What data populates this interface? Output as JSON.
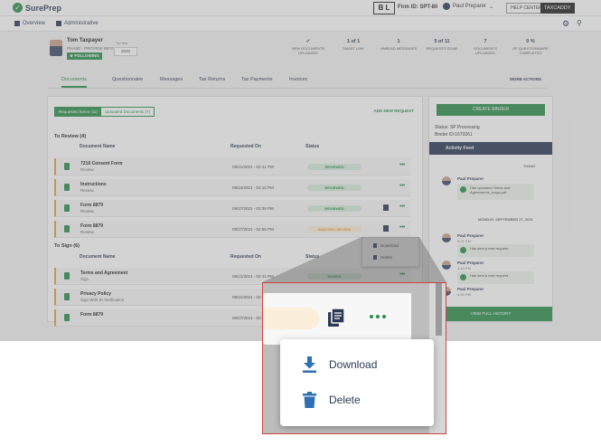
{
  "app": {
    "brand": "SurePrep",
    "bl_badge": "B L",
    "firm_id": "Firm ID: SPT-80",
    "user_name": "Paul Preparer",
    "help_center": "HELP CENTER",
    "taxcaddy": "TAXCADDY"
  },
  "nav": {
    "overview": "Overview",
    "administrative": "Administrative"
  },
  "client": {
    "name": "Tom Taxpayer",
    "phase": "PHASE - PROVIDE INFO",
    "following": "★ FOLLOWING",
    "tax_year_label": "Tax Year",
    "tax_year": "2020"
  },
  "stats": [
    {
      "value": "✓",
      "label": "NEW DOCUMENTS UPLOADED"
    },
    {
      "value": "1 of 1",
      "label": "SMART LINK"
    },
    {
      "value": "1",
      "label": "UNREAD MESSAGES"
    },
    {
      "value": "5 of 11",
      "label": "REQUESTS DONE"
    },
    {
      "value": "7",
      "label": "DOCUMENTS UPLOADED"
    },
    {
      "value": "0 %",
      "label": "OF QUESTIONNAIRE COMPLETED"
    }
  ],
  "tabs": [
    "Documents",
    "Questionnaire",
    "Messages",
    "Tax Returns",
    "Tax Payments",
    "Invoices"
  ],
  "more_actions": "MORE ACTIONS",
  "subtabs": {
    "requested": "Requested Items (11)",
    "uploaded": "Uploaded Documents (7)"
  },
  "add_request": "ADD NEW REQUEST",
  "to_review": {
    "title": "To Review (4)",
    "columns": {
      "name": "Document Name",
      "date": "Requested On",
      "status": "Status"
    },
    "rows": [
      {
        "name": "7216 Consent Form",
        "sub": "Review",
        "date": "09/21/2021 - 02:41 PM",
        "status": "REVIEWED"
      },
      {
        "name": "Instructions",
        "sub": "Review",
        "date": "09/24/2021 - 03:10 PM",
        "status": "REVIEWED"
      },
      {
        "name": "Form 8879",
        "sub": "Review",
        "date": "09/27/2021 - 02:39 PM",
        "status": "REVIEWED"
      },
      {
        "name": "Form 8879",
        "sub": "Review",
        "date": "09/27/2021 - 02:56 PM",
        "status": "AWAITING REVIEW"
      }
    ]
  },
  "to_sign": {
    "title": "To Sign (6)",
    "columns": {
      "name": "Document Name",
      "date": "Requested On",
      "status": "Status"
    },
    "rows": [
      {
        "name": "Terms and Agreement",
        "sub": "Sign",
        "date": "09/21/2021 - 02:41 PM",
        "status": "SIGNED"
      },
      {
        "name": "Privacy Policy",
        "sub": "Sign With ID Verification",
        "date": "09/21/2021 - 02:41 PM",
        "status": ""
      },
      {
        "name": "Form 8879",
        "sub": "",
        "date": "09/27/2021 - 02:41 PM",
        "status": ""
      }
    ]
  },
  "side": {
    "create_binder": "CREATE BINDER",
    "status": "Status: SP Processing",
    "binder_id": "Binder ID:1670261",
    "activity_feed": "Activity Feed",
    "today": "TODAY",
    "date_header": "MONDAY, SEPTEMBER 27, 2021",
    "items": [
      {
        "name": "Paul Preparer",
        "time": "",
        "text": "Has uploaded Terms and Agreements_mogo.pdf"
      },
      {
        "name": "Paul Preparer",
        "time": "5:01 PM",
        "text": "Has sent a new request."
      },
      {
        "name": "Paul Preparer",
        "time": "4:40 PM",
        "text": "Has sent a new request."
      },
      {
        "name": "Paul Preparer",
        "time": "4:39 PM",
        "text": "Has sent a new request."
      }
    ],
    "view_history": "VIEW FULL HISTORY"
  },
  "dropdown": {
    "download": "Download",
    "delete": "Delete"
  },
  "colors": {
    "accent": "#2a8f4a",
    "navy": "#2b3a55",
    "awaiting": "#e0a63a",
    "callout_border": "#d0453f"
  }
}
